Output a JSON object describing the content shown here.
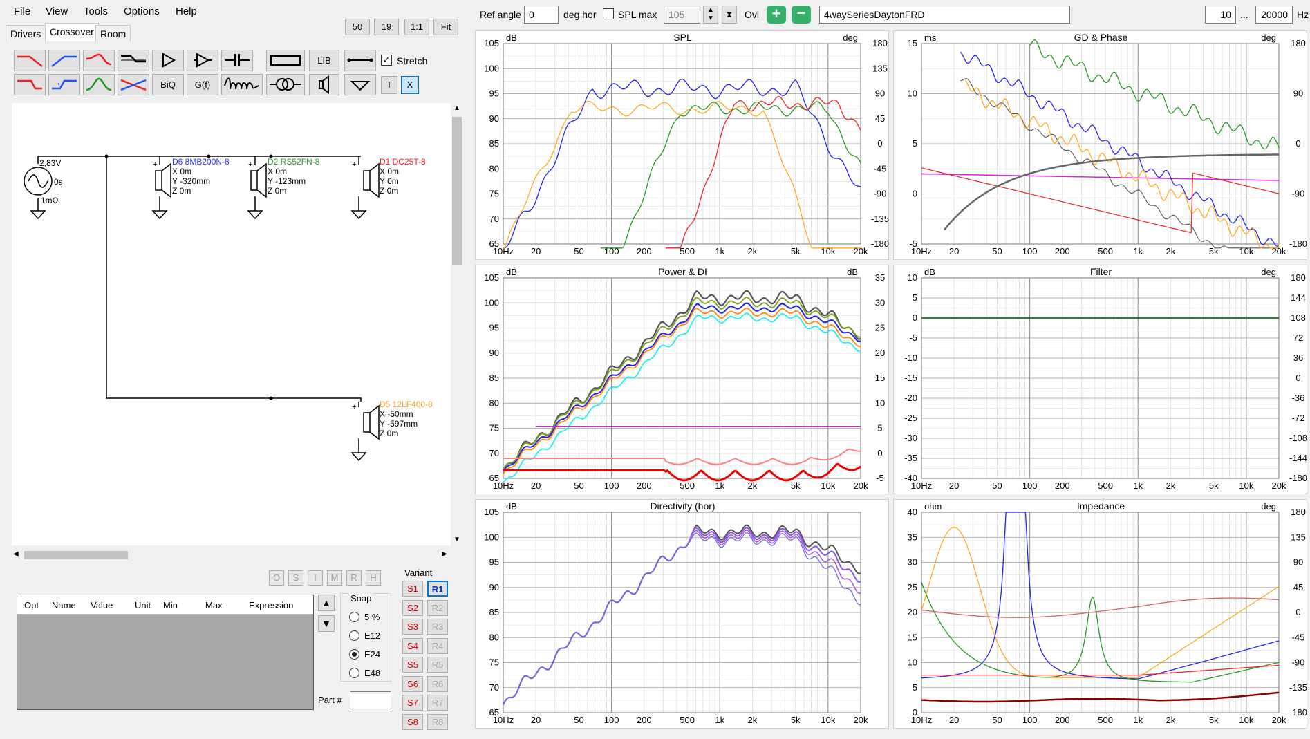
{
  "menu": [
    "File",
    "View",
    "Tools",
    "Options",
    "Help"
  ],
  "tabs": [
    "Drivers",
    "Crossover",
    "Room"
  ],
  "top_buttons": [
    "50",
    "19",
    "1:1",
    "Fit"
  ],
  "toolbar": {
    "lib": "LIB",
    "biq": "BiQ",
    "gf": "G(f)",
    "t": "T",
    "x": "X",
    "stretch_label": "Stretch",
    "stretch_checked": true
  },
  "schematic": {
    "source": {
      "voltage": "2,83V",
      "delay": "0s",
      "resistance": "1mΩ"
    },
    "drivers": [
      {
        "name": "D6 8MB200N-8",
        "color": "#3333ff",
        "x": "X 0m",
        "y": "Y -320mm",
        "z": "Z 0m"
      },
      {
        "name": "D2 RS52FN-8",
        "color": "#339933",
        "x": "X 0m",
        "y": "Y -123mm",
        "z": "Z 0m"
      },
      {
        "name": "D1 DC25T-8",
        "color": "#ff2222",
        "x": "X 0m",
        "y": "Y 0m",
        "z": "Z 0m"
      },
      {
        "name": "D5 12LF400-8",
        "color": "#ffa020",
        "x": "X -50mm",
        "y": "Y -597mm",
        "z": "Z 0m"
      }
    ]
  },
  "bottom_mini_buttons": [
    "O",
    "S",
    "I",
    "M",
    "R",
    "H"
  ],
  "param_table": {
    "columns": [
      "Opt",
      "Name",
      "Value",
      "Unit",
      "Min",
      "Max",
      "Expression"
    ]
  },
  "snap": {
    "label": "Snap",
    "options": [
      "5 %",
      "E12",
      "E24",
      "E48"
    ],
    "selected": "E24"
  },
  "part_label": "Part #",
  "variant": {
    "label": "Variant",
    "s": [
      "S1",
      "S2",
      "S3",
      "S4",
      "S5",
      "S6",
      "S7",
      "S8"
    ],
    "r": [
      "R1",
      "R2",
      "R3",
      "R4",
      "R5",
      "R6",
      "R7",
      "R8"
    ]
  },
  "topbar": {
    "ref_angle_label": "Ref angle",
    "ref_angle": "0",
    "deg_hor": "deg hor",
    "spl_max_label": "SPL max",
    "spl_max": "105",
    "ovl": "Ovl",
    "project": "4waySeriesDaytonFRD",
    "f_min": "10",
    "f_sep": "...",
    "f_max": "20000",
    "hz": "Hz"
  },
  "plots": [
    {
      "title": "SPL",
      "unitL": "dB",
      "unitR": "deg",
      "yL": [
        "105",
        "100",
        "95",
        "90",
        "85",
        "80",
        "75",
        "70",
        "65"
      ],
      "yR": [
        "180",
        "135",
        "90",
        "45",
        "0",
        "-45",
        "-90",
        "-135",
        "-180"
      ],
      "x": [
        "10Hz",
        "20",
        "50",
        "100",
        "200",
        "500",
        "1k",
        "2k",
        "5k",
        "10k",
        "20k"
      ]
    },
    {
      "title": "GD & Phase",
      "unitL": "ms",
      "unitR": "deg",
      "yL": [
        "15",
        "10",
        "5",
        "0",
        "-5"
      ],
      "yR": [
        "180",
        "90",
        "0",
        "-90",
        "-180"
      ],
      "x": [
        "10Hz",
        "20",
        "50",
        "100",
        "200",
        "500",
        "1k",
        "2k",
        "5k",
        "10k",
        "20k"
      ]
    },
    {
      "title": "Power & DI",
      "unitL": "dB",
      "unitR": "dB",
      "yL": [
        "105",
        "100",
        "95",
        "90",
        "85",
        "80",
        "75",
        "70",
        "65"
      ],
      "yR": [
        "35",
        "30",
        "25",
        "20",
        "15",
        "10",
        "5",
        "0",
        "-5"
      ],
      "x": [
        "10Hz",
        "20",
        "50",
        "100",
        "200",
        "500",
        "1k",
        "2k",
        "5k",
        "10k",
        "20k"
      ]
    },
    {
      "title": "Filter",
      "unitL": "dB",
      "unitR": "deg",
      "yL": [
        "10",
        "5",
        "0",
        "-5",
        "-10",
        "-15",
        "-20",
        "-25",
        "-30",
        "-35",
        "-40"
      ],
      "yR": [
        "180",
        "144",
        "108",
        "72",
        "36",
        "0",
        "-36",
        "-72",
        "-108",
        "-144",
        "-180"
      ],
      "x": [
        "10Hz",
        "20",
        "50",
        "100",
        "200",
        "500",
        "1k",
        "2k",
        "5k",
        "10k",
        "20k"
      ]
    },
    {
      "title": "Directivity (hor)",
      "unitL": "dB",
      "unitR": "",
      "yL": [
        "105",
        "100",
        "95",
        "90",
        "85",
        "80",
        "75",
        "70",
        "65"
      ],
      "yR": [],
      "x": [
        "10Hz",
        "20",
        "50",
        "100",
        "200",
        "500",
        "1k",
        "2k",
        "5k",
        "10k",
        "20k"
      ]
    },
    {
      "title": "Impedance",
      "unitL": "ohm",
      "unitR": "deg",
      "yL": [
        "40",
        "35",
        "30",
        "25",
        "20",
        "15",
        "10",
        "5",
        "0"
      ],
      "yR": [
        "180",
        "135",
        "90",
        "45",
        "0",
        "-45",
        "-90",
        "-135",
        "-180"
      ],
      "x": [
        "10Hz",
        "20",
        "50",
        "100",
        "200",
        "500",
        "1k",
        "2k",
        "5k",
        "10k",
        "20k"
      ]
    }
  ],
  "curve_colors": {
    "blue": "#2222ee",
    "green": "#229922",
    "red": "#ee2222",
    "orange": "#ffaa22",
    "gray": "#555555",
    "cyan": "#22eeee",
    "magenta": "#dd22dd",
    "purple": "#8855ee"
  }
}
